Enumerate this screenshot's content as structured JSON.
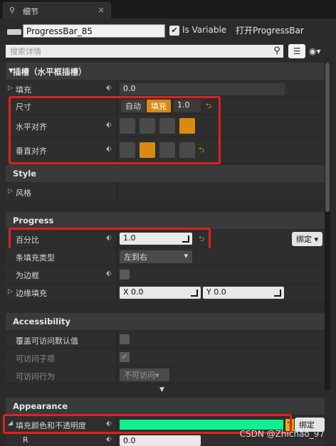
{
  "tab": {
    "label": "细节",
    "close": "×"
  },
  "widget": {
    "name": "ProgressBar_85",
    "is_variable_label": "Is Variable",
    "is_variable_checked": "✔",
    "open_label": "打开ProgressBar"
  },
  "search": {
    "placeholder": "搜索详情"
  },
  "icons": {
    "search": "⚲",
    "grid": "☰",
    "eye": "◉▾",
    "reset": "⮌",
    "pin": "⬖",
    "check": "✔",
    "collapse": "▼"
  },
  "sections": {
    "slot": {
      "title": "插槽（水平框插槽）",
      "padding_label": "填充",
      "padding_value": "0.0",
      "size_label": "尺寸",
      "size_auto": "自动",
      "size_fill": "填充",
      "size_value": "1.0",
      "halign_label": "水平对齐",
      "valign_label": "垂直对齐"
    },
    "style": {
      "title": "Style",
      "style_label": "风格"
    },
    "progress": {
      "title": "Progress",
      "percent_label": "百分比",
      "percent_value": "1.0",
      "bind_label": "绑定",
      "fill_type_label": "条填充类型",
      "fill_type_value": "左到右",
      "is_marquee_label": "为边框",
      "border_padding_label": "边缘填充",
      "x_label": "X",
      "x_value": "0.0",
      "y_label": "Y",
      "y_value": "0.0"
    },
    "accessibility": {
      "title": "Accessibility",
      "override_label": "覆盖可访问默认值",
      "children_label": "可访问子项",
      "behavior_label": "可访问行为",
      "behavior_value": "不可访问"
    },
    "appearance": {
      "title": "Appearance",
      "fill_color_label": "填充颜色和不透明度",
      "bind_label": "绑定",
      "r_label": "R",
      "r_value": "0.0",
      "fill_color": "#10f090"
    }
  },
  "watermark": "CSDN @Zhichao_97"
}
